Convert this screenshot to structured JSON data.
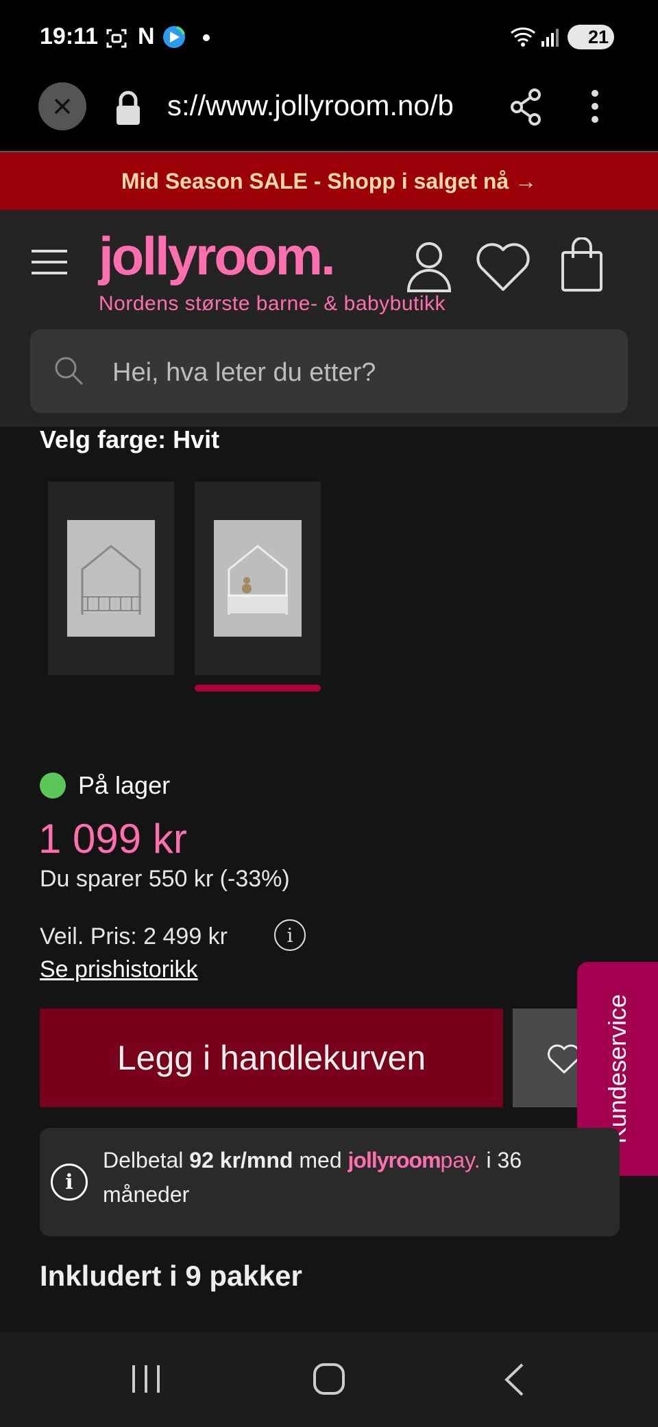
{
  "status_bar": {
    "time": "19:11",
    "n_letter": "N",
    "battery": "21"
  },
  "browser": {
    "url": "s://www.jollyroom.no/b"
  },
  "sale_banner": {
    "text": "Mid Season SALE - Shopp i salget nå →"
  },
  "header": {
    "logo": "jollyroom.",
    "tagline": "Nordens største barne- & babybutikk",
    "search_placeholder": "Hei, hva leter du etter?"
  },
  "product": {
    "color_label": "Velg farge: Hvit",
    "stock": "På lager",
    "price": "1 099 kr",
    "savings": "Du sparer 550 kr (-33%)",
    "recommended_price": "Veil. Pris: 2 499 kr",
    "info_symbol": "i",
    "price_history": "Se prishistorikk",
    "add_to_cart": "Legg i handlekurven"
  },
  "installment": {
    "prefix": "Delbetal ",
    "amount": "92 kr/mnd",
    "med": " med ",
    "logo_main": "jollyroom",
    "logo_suffix": "pay.",
    "suffix": " i 36 måneder"
  },
  "customer_service": "Kundeservice",
  "packages_heading": "Inkludert i 9 pakker",
  "colors": {
    "accent_pink": "#ff6fb0",
    "banner_red": "#9c0009",
    "cart_button": "#78001a",
    "in_stock_green": "#5cc65a"
  }
}
